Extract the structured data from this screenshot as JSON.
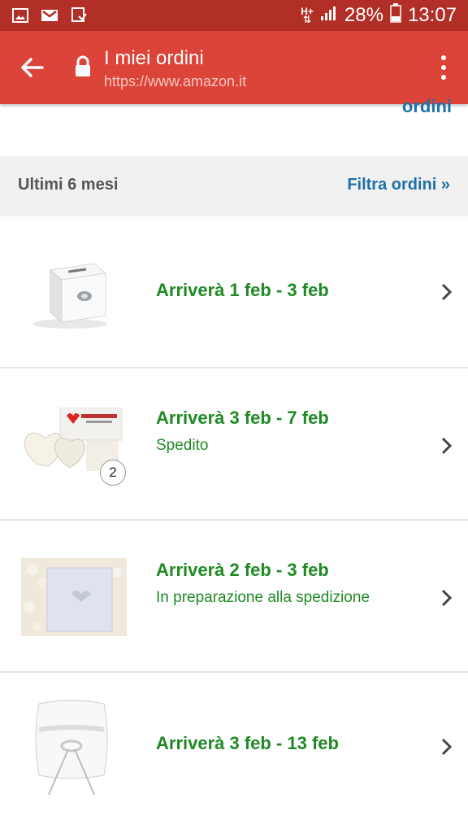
{
  "status_bar": {
    "network": "H+",
    "battery": "28%",
    "time": "13:07"
  },
  "browser": {
    "title": "I miei ordini",
    "url": "https://www.amazon.it"
  },
  "top_link": "ordini",
  "filter_bar": {
    "period": "Ultimi 6 mesi",
    "filter_label": "Filtra ordini »"
  },
  "orders": [
    {
      "arrival": "Arriverà 1 feb - 3 feb",
      "status": "",
      "image": "white-box"
    },
    {
      "arrival": "Arriverà 3 feb - 7 feb",
      "status": "Spedito",
      "image": "heart-balloons",
      "quantity": "2"
    },
    {
      "arrival": "Arriverà 2 feb - 3 feb",
      "status": "In preparazione alla spedizione",
      "image": "card-with-petals"
    },
    {
      "arrival": "Arriverà 3 feb - 13 feb",
      "status": "",
      "image": "ring-pillow"
    }
  ],
  "colors": {
    "status_bar": "#b22f27",
    "browser_bar": "#dc443a",
    "link": "#1f6fa8",
    "arrival_green": "#1f8a24"
  }
}
